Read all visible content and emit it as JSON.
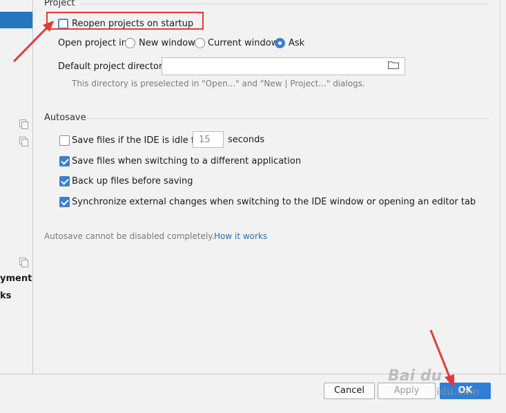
{
  "sidebar": {
    "fragments": [
      "yment",
      "ks"
    ]
  },
  "project": {
    "section_title": "Project",
    "reopen_label": "Reopen projects on startup",
    "open_in_label": "Open project in",
    "open_options": [
      "New window",
      "Current window",
      "Ask"
    ],
    "open_selected": "Ask",
    "default_dir_label": "Default project directory:",
    "default_dir_value": "",
    "dir_hint": "This directory is preselected in \"Open...\" and \"New | Project...\" dialogs."
  },
  "autosave": {
    "section_title": "Autosave",
    "idle_label": "Save files if the IDE is idle for",
    "idle_value": "15",
    "idle_unit": "seconds",
    "switch_app_label": "Save files when switching to a different application",
    "backup_label": "Back up files before saving",
    "sync_label": "Synchronize external changes when switching to the IDE window or opening an editor tab",
    "note": "Autosave cannot be disabled completely.",
    "how_link": "How it works"
  },
  "buttons": {
    "cancel": "Cancel",
    "apply": "Apply",
    "ok": "OK"
  },
  "watermark": {
    "text": "Bai du",
    "url_fragment": "idu.com"
  },
  "colors": {
    "accent": "#2f7ed8",
    "highlight": "#e53935",
    "selection": "#2675bf"
  }
}
